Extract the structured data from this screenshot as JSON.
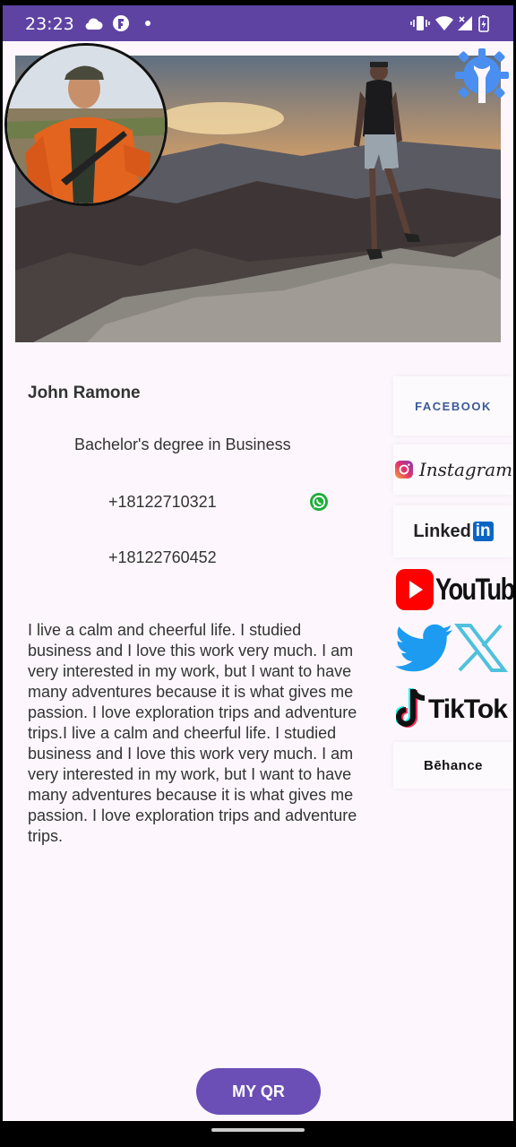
{
  "status_bar": {
    "time": "23:23"
  },
  "profile": {
    "name": "John Ramone",
    "degree": "Bachelor's degree in Business",
    "phones": [
      "+18122710321",
      "+18122760452"
    ],
    "bio": "I live a calm and cheerful life. I studied business and I love this work very much. I am very interested in my work, but I want to have many adventures because it is what gives me passion. I love exploration trips and adventure trips.I live a calm and cheerful life. I studied business and I love this work very much. I am very interested in my work, but I want to have many adventures because it is what gives me passion. I love exploration trips and adventure trips."
  },
  "socials": {
    "facebook": "FACEBOOK",
    "instagram": "Instagram",
    "linkedin_a": "Linked",
    "linkedin_b": "in",
    "youtube": "YouTube",
    "tiktok": "TikTok",
    "behance": "Bēhance"
  },
  "qr_button": {
    "label": "MY QR"
  },
  "colors": {
    "status_bar": "#5e43a3",
    "primary": "#6b4fb6",
    "background": "#fdf7fd"
  }
}
